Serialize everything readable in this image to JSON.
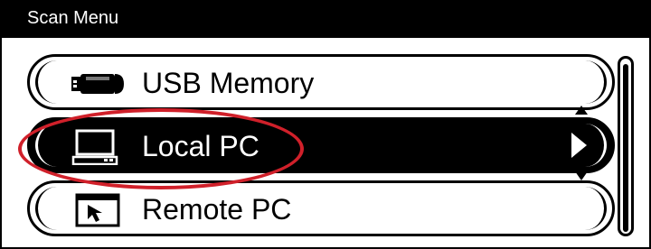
{
  "window": {
    "title": "Scan Menu"
  },
  "menu": {
    "items": [
      {
        "label": "USB Memory",
        "icon": "usb-drive-icon",
        "selected": false
      },
      {
        "label": "Local PC",
        "icon": "computer-icon",
        "selected": true
      },
      {
        "label": "Remote PC",
        "icon": "remote-pc-icon",
        "selected": false
      }
    ]
  },
  "colors": {
    "highlight": "#000000",
    "annotation": "#d0202a"
  }
}
